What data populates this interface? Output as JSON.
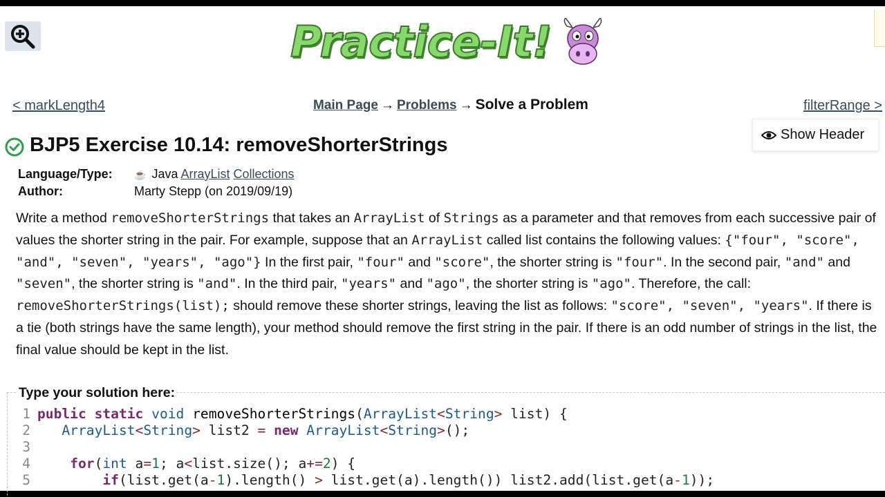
{
  "header": {
    "logo_text": "Practice-It!",
    "zoom_icon": "zoom-in-icon",
    "cow_icon": "cow-mascot-icon"
  },
  "nav": {
    "prev_link": "< markLength4",
    "next_link": "filterRange >",
    "breadcrumb": {
      "main_page": "Main Page",
      "arrow1": "→",
      "problems": "Problems",
      "arrow2": "→",
      "current": "Solve a Problem"
    },
    "show_header_button": "Show Header",
    "show_header_icon": "eye-icon"
  },
  "problem": {
    "status_icon": "check-circle-icon",
    "status_color": "#2e9e4a",
    "title": "BJP5 Exercise 10.14: removeShorterStrings",
    "language_label": "Language/Type:",
    "language_icon": "java-cup-icon",
    "language": "Java",
    "tag1": "ArrayList",
    "tag2": "Collections",
    "author_label": "Author:",
    "author": "Marty Stepp (on 2019/09/19)"
  },
  "description": {
    "t1": "Write a method ",
    "c1": "removeShorterStrings",
    "t2": " that takes an ",
    "c2": "ArrayList",
    "t3": " of ",
    "c3": "Strings",
    "t4": " as a parameter and that removes from each successive pair of values the shorter string in the pair. For example, suppose that an ",
    "c4": "ArrayList",
    "t5": " called list contains the following values: ",
    "c5": "{\"four\", \"score\", \"and\", \"seven\", \"years\", \"ago\"}",
    "t6": " In the first pair, ",
    "c6": "\"four\"",
    "t7": " and ",
    "c7": "\"score\"",
    "t8": ", the shorter string is ",
    "c8": "\"four\"",
    "t9": ". In the second pair, ",
    "c9": "\"and\"",
    "t10": " and ",
    "c10": "\"seven\"",
    "t11": ", the shorter string is ",
    "c11": "\"and\"",
    "t12": ". In the third pair, ",
    "c12": "\"years\"",
    "t13": " and ",
    "c13": "\"ago\"",
    "t14": ", the shorter string is ",
    "c14": "\"ago\"",
    "t15": ". Therefore, the call: ",
    "c15": "removeShorterStrings(list);",
    "t16": " should remove these shorter strings, leaving the list as follows: ",
    "c16": "\"score\", \"seven\", \"years\"",
    "t17": ". If there is a tie (both strings have the same length), your method should remove the first string in the pair. If there is an odd number of strings in the list, the final value should be kept in the list."
  },
  "solution": {
    "label": "Type your solution here:",
    "line_numbers": [
      "1",
      "2",
      "3",
      "4",
      "5"
    ],
    "l1": {
      "kw1": "public",
      "kw2": "static",
      "kw3": "void",
      "name": "removeShorterStrings",
      "p1": "(",
      "ty1": "ArrayList",
      "op1": "<",
      "ty2": "String",
      "op2": ">",
      "rest": " list) {"
    },
    "l2": {
      "ty1": "ArrayList",
      "op1": "<",
      "ty2": "String",
      "op2": ">",
      "mid": " list2 ",
      "op3": "=",
      "kw": "new",
      "ty3": "ArrayList",
      "op4": "<",
      "ty4": "String",
      "op5": ">",
      "rest": "();"
    },
    "l4": {
      "kw1": "for",
      "p1": "(",
      "kw2": "int",
      "a1": " a",
      "op1": "=",
      "n1": "1",
      "mid": "; a",
      "op2": "<",
      "mid2": "list.size(); a",
      "op3": "+=",
      "n2": "2",
      "rest": ") {"
    },
    "l5": {
      "kw": "if",
      "a": "(list.get(a",
      "op1": "-",
      "n1": "1",
      "b": ").length() ",
      "op2": ">",
      "c": " list.get(a).length()) list2.add(list.get(a",
      "op3": "-",
      "n2": "1",
      "d": "));"
    }
  }
}
